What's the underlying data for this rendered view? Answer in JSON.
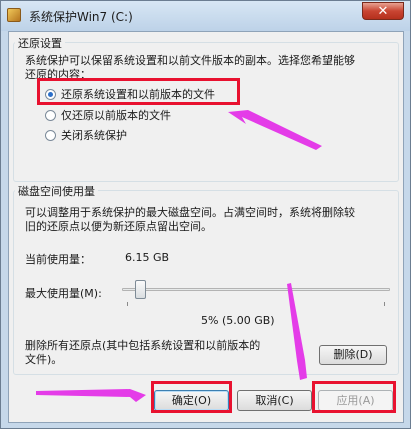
{
  "window": {
    "title": "系统保护Win7 (C:)",
    "close_label": "✕"
  },
  "restore_settings": {
    "group_title": "还原设置",
    "description_line1": "系统保护可以保留系统设置和以前文件版本的副本。选择您希望能够",
    "description_line2": "还原的内容：",
    "options": [
      {
        "label": "还原系统设置和以前版本的文件",
        "checked": true
      },
      {
        "label": "仅还原以前版本的文件",
        "checked": false
      },
      {
        "label": "关闭系统保护",
        "checked": false
      }
    ]
  },
  "disk_space": {
    "group_title": "磁盘空间使用量",
    "description_line1": "可以调整用于系统保护的最大磁盘空间。占满空间时，系统将删除较",
    "description_line2": "旧的还原点以便为新还原点留出空间。",
    "current_usage_label": "当前使用量：",
    "current_usage_value": "6.15 GB",
    "max_usage_label": "最大使用量(M):",
    "max_usage_fraction": 0.05,
    "max_usage_display": "5% (5.00 GB)",
    "delete_text_line1": "删除所有还原点(其中包括系统设置和以前版本的",
    "delete_text_line2": "文件)。",
    "delete_button": "删除(D)"
  },
  "footer": {
    "ok_button": "确定(O)",
    "cancel_button": "取消(C)",
    "apply_button": "应用(A)"
  },
  "colors": {
    "highlight_red": "#e8112f",
    "arrow_magenta": "#e43ce8"
  }
}
